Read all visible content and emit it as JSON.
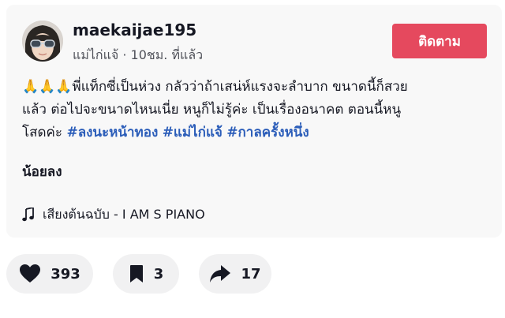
{
  "post": {
    "username": "maekaijae195",
    "meta": "แม่ไก่แจ้ · 10ชม. ที่แล้ว",
    "follow_label": "ติดตาม",
    "description": {
      "emojis": "🙏🙏🙏",
      "line1_text": "พี่แท็กซี่เป็นห่วง กลัวว่าถ้าเสน่ห์แรงจะลำบาก ขนาดนี้ก็สวย",
      "line2_text": "แล้ว ต่อไปจะขนาดไหนเนี่ย หนูก็ไม่รู้ค่ะ เป็นเรื่องอนาคต ตอนนี้หนู",
      "line3_text": "โสดค่ะ",
      "hashtags": [
        "#ลงนะหน้าทอง",
        "#แม่ไก่แจ้",
        "#กาลครั้งหนึ่ง"
      ]
    },
    "sub_text": "น้อยลง",
    "music": {
      "icon": "music-note-icon",
      "label": "เสียงต้นฉบับ - I AM S PIANO"
    }
  },
  "actions": {
    "likes": "393",
    "bookmarks": "3",
    "shares": "17"
  },
  "colors": {
    "follow_button": "#e5495e",
    "hashtag": "#2b5db9",
    "card_bg": "#f8f8f8",
    "pill_bg": "#f1f1f2"
  }
}
